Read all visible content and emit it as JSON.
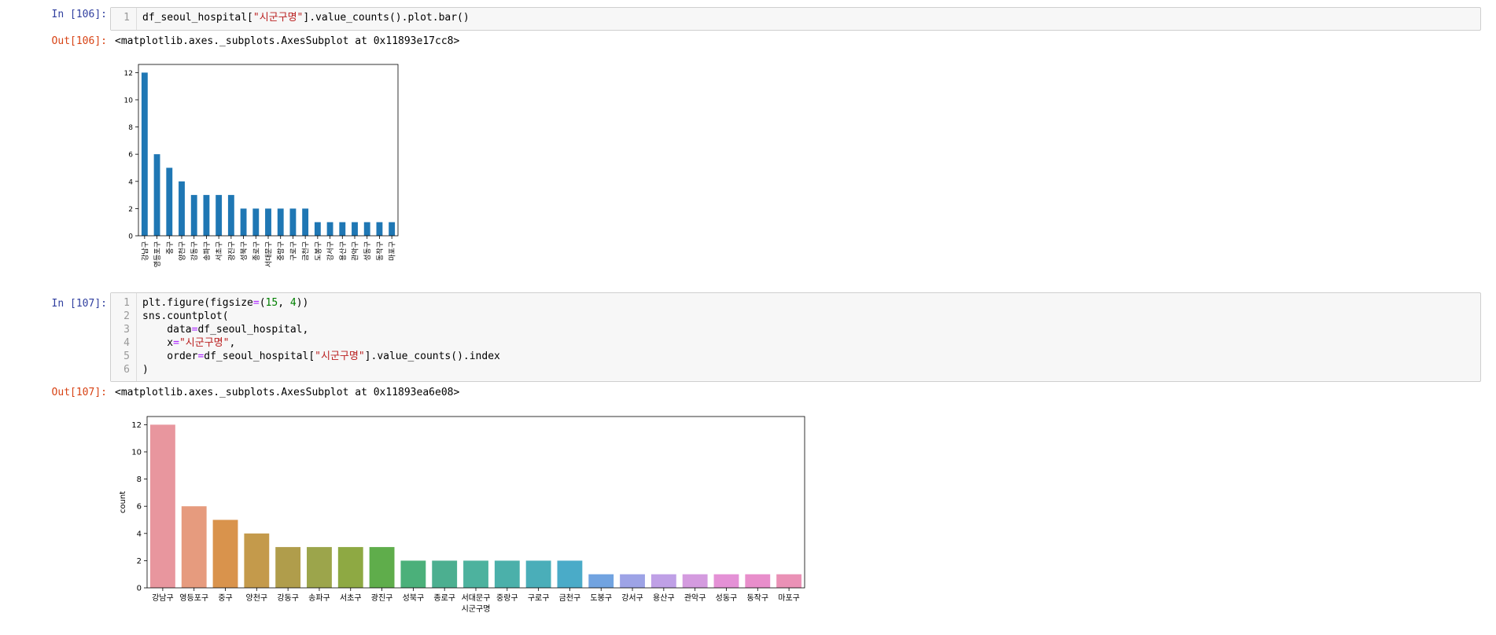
{
  "colors": {
    "in_prompt": "#303f9f",
    "out_prompt": "#d84315",
    "string": "#ba2121",
    "number": "#008000",
    "operator": "#aa22ff",
    "bar_matplotlib": "#1f77b4"
  },
  "cells": [
    {
      "in_prompt": "In [106]:",
      "lines": [
        {
          "num": "1",
          "tokens": [
            {
              "t": "df_seoul_hospital[",
              "c": "plain"
            },
            {
              "t": "\"시군구명\"",
              "c": "string"
            },
            {
              "t": "].value_counts().plot.bar()",
              "c": "plain"
            }
          ]
        }
      ],
      "out_prompt": "Out[106]:",
      "out_text": "<matplotlib.axes._subplots.AxesSubplot at 0x11893e17cc8>"
    },
    {
      "in_prompt": "In [107]:",
      "lines": [
        {
          "num": "1",
          "tokens": [
            {
              "t": "plt.figure(figsize",
              "c": "plain"
            },
            {
              "t": "=",
              "c": "operator"
            },
            {
              "t": "(",
              "c": "plain"
            },
            {
              "t": "15",
              "c": "number"
            },
            {
              "t": ", ",
              "c": "plain"
            },
            {
              "t": "4",
              "c": "number"
            },
            {
              "t": "))",
              "c": "plain"
            }
          ]
        },
        {
          "num": "2",
          "tokens": [
            {
              "t": "sns.countplot(",
              "c": "plain"
            }
          ]
        },
        {
          "num": "3",
          "tokens": [
            {
              "t": "    data",
              "c": "plain"
            },
            {
              "t": "=",
              "c": "operator"
            },
            {
              "t": "df_seoul_hospital,",
              "c": "plain"
            }
          ]
        },
        {
          "num": "4",
          "tokens": [
            {
              "t": "    x",
              "c": "plain"
            },
            {
              "t": "=",
              "c": "operator"
            },
            {
              "t": "\"시군구명\"",
              "c": "string"
            },
            {
              "t": ",",
              "c": "plain"
            }
          ]
        },
        {
          "num": "5",
          "tokens": [
            {
              "t": "    order",
              "c": "plain"
            },
            {
              "t": "=",
              "c": "operator"
            },
            {
              "t": "df_seoul_hospital[",
              "c": "plain"
            },
            {
              "t": "\"시군구명\"",
              "c": "string"
            },
            {
              "t": "].value_counts().index",
              "c": "plain"
            }
          ]
        },
        {
          "num": "6",
          "tokens": [
            {
              "t": ")",
              "c": "plain"
            }
          ]
        }
      ],
      "out_prompt": "Out[107]:",
      "out_text": "<matplotlib.axes._subplots.AxesSubplot at 0x11893ea6e08>"
    }
  ],
  "chart_data": [
    {
      "type": "bar",
      "categories": [
        "강남구",
        "영등포구",
        "중구",
        "양천구",
        "강동구",
        "송파구",
        "서초구",
        "광진구",
        "성북구",
        "종로구",
        "서대문구",
        "중랑구",
        "구로구",
        "금천구",
        "도봉구",
        "강서구",
        "용산구",
        "관악구",
        "성동구",
        "동작구",
        "마포구"
      ],
      "values": [
        12,
        6,
        5,
        4,
        3,
        3,
        3,
        3,
        2,
        2,
        2,
        2,
        2,
        2,
        1,
        1,
        1,
        1,
        1,
        1,
        1
      ],
      "yticks": [
        "0",
        "2",
        "4",
        "6",
        "8",
        "10",
        "12"
      ],
      "ylim": [
        0,
        12.6
      ],
      "xlabel": "",
      "ylabel": "",
      "grid": false,
      "color": "#1f77b4"
    },
    {
      "type": "bar",
      "categories": [
        "강남구",
        "영등포구",
        "중구",
        "양천구",
        "강동구",
        "송파구",
        "서초구",
        "광진구",
        "성북구",
        "종로구",
        "서대문구",
        "중랑구",
        "구로구",
        "금천구",
        "도봉구",
        "강서구",
        "용산구",
        "관악구",
        "성동구",
        "동작구",
        "마포구"
      ],
      "values": [
        12,
        6,
        5,
        4,
        3,
        3,
        3,
        3,
        2,
        2,
        2,
        2,
        2,
        2,
        1,
        1,
        1,
        1,
        1,
        1,
        1
      ],
      "yticks": [
        "0",
        "2",
        "4",
        "6",
        "8",
        "10",
        "12"
      ],
      "ylim": [
        0,
        12.6
      ],
      "xlabel": "시군구명",
      "ylabel": "count",
      "grid": false,
      "colors": [
        "#e8969e",
        "#e69b7e",
        "#d9934c",
        "#c49a4b",
        "#b09d4b",
        "#9ca54b",
        "#8ea943",
        "#5fad4b",
        "#4bb07a",
        "#4caf90",
        "#4db29e",
        "#4bb0aa",
        "#4aaeb9",
        "#4aabc8",
        "#71a3e0",
        "#9da3e6",
        "#bfa0e6",
        "#d49bdf",
        "#e491d6",
        "#e88ecb",
        "#ea91b6"
      ]
    }
  ]
}
